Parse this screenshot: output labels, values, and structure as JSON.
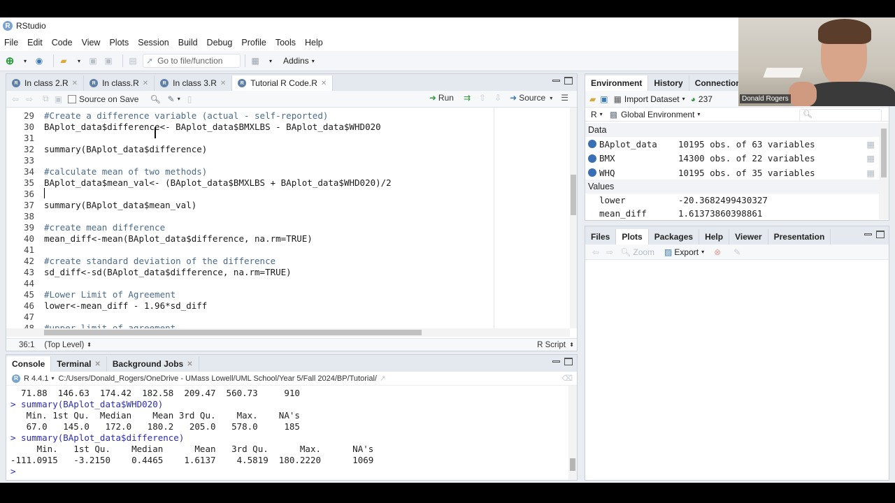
{
  "app": {
    "title": "RStudio"
  },
  "menu": [
    "File",
    "Edit",
    "Code",
    "View",
    "Plots",
    "Session",
    "Build",
    "Debug",
    "Profile",
    "Tools",
    "Help"
  ],
  "toolbar": {
    "goto_placeholder": "Go to file/function",
    "addins": "Addins"
  },
  "source": {
    "tabs": [
      {
        "label": "In class 2.R",
        "active": false
      },
      {
        "label": "In class.R",
        "active": false
      },
      {
        "label": "In class 3.R",
        "active": false
      },
      {
        "label": "Tutorial R Code.R",
        "active": true
      }
    ],
    "source_on_save": "Source on Save",
    "run": "Run",
    "source_btn": "Source",
    "lines": [
      {
        "n": "29",
        "code": "#Create a difference variable (actual - self-reported)",
        "type": "comment"
      },
      {
        "n": "30",
        "code": "BAplot_data$difference<- BAplot_data$BMXLBS - BAplot_data$WHD020",
        "type": "code"
      },
      {
        "n": "31",
        "code": "",
        "type": "code"
      },
      {
        "n": "32",
        "code": "summary(BAplot_data$difference)",
        "type": "code"
      },
      {
        "n": "33",
        "code": "",
        "type": "code"
      },
      {
        "n": "34",
        "code": "#calculate mean of two methods)",
        "type": "comment"
      },
      {
        "n": "35",
        "code": "BAplot_data$mean_val<- (BAplot_data$BMXLBS + BAplot_data$WHD020)/2",
        "type": "code"
      },
      {
        "n": "36",
        "code": "",
        "type": "code"
      },
      {
        "n": "37",
        "code": "summary(BAplot_data$mean_val)",
        "type": "code"
      },
      {
        "n": "38",
        "code": "",
        "type": "code"
      },
      {
        "n": "39",
        "code": "#create mean difference",
        "type": "comment"
      },
      {
        "n": "40",
        "code": "mean_diff<-mean(BAplot_data$difference, na.rm=TRUE)",
        "type": "code"
      },
      {
        "n": "41",
        "code": "",
        "type": "code"
      },
      {
        "n": "42",
        "code": "#create standard deviation of the difference",
        "type": "comment"
      },
      {
        "n": "43",
        "code": "sd_diff<-sd(BAplot_data$difference, na.rm=TRUE)",
        "type": "code"
      },
      {
        "n": "44",
        "code": "",
        "type": "code"
      },
      {
        "n": "45",
        "code": "#Lower Limit of Agreement",
        "type": "comment"
      },
      {
        "n": "46",
        "code": "lower<-mean_diff - 1.96*sd_diff",
        "type": "code"
      },
      {
        "n": "47",
        "code": "",
        "type": "code"
      },
      {
        "n": "48",
        "code": "#upper limit of agreement",
        "type": "comment"
      }
    ],
    "position": "36:1",
    "scope": "(Top Level)",
    "filetype": "R Script"
  },
  "console": {
    "tabs": [
      "Console",
      "Terminal",
      "Background Jobs"
    ],
    "r_version": "R 4.4.1",
    "path": "C:/Users/Donald_Rogers/OneDrive - UMass Lowell/UML School/Year 5/Fall 2024/BP/Tutorial/",
    "lines": [
      {
        "text": "  71.88  146.63  174.42  182.58  209.47  560.73     910",
        "type": "out"
      },
      {
        "text": "> summary(BAplot_data$WHD020)",
        "type": "cmd"
      },
      {
        "text": "   Min. 1st Qu.  Median    Mean 3rd Qu.    Max.    NA's ",
        "type": "out"
      },
      {
        "text": "   67.0   145.0   172.0   180.2   205.0   578.0     185 ",
        "type": "out"
      },
      {
        "text": "> summary(BAplot_data$difference)",
        "type": "cmd"
      },
      {
        "text": "     Min.   1st Qu.    Median      Mean   3rd Qu.      Max.      NA's ",
        "type": "out"
      },
      {
        "text": "-111.0915   -3.2150    0.4465    1.6137    4.5819  180.2220      1069 ",
        "type": "out"
      },
      {
        "text": "> ",
        "type": "cmd"
      }
    ]
  },
  "environment": {
    "tabs": [
      "Environment",
      "History",
      "Connections"
    ],
    "import_dataset": "Import Dataset",
    "memory": "237",
    "lang": "R",
    "scope": "Global Environment",
    "data_header": "Data",
    "data": [
      {
        "name": "BAplot_data",
        "value": "10195 obs. of 63 variables"
      },
      {
        "name": "BMX",
        "value": "14300 obs. of 22 variables"
      },
      {
        "name": "WHQ",
        "value": "10195 obs. of 35 variables"
      }
    ],
    "values_header": "Values",
    "values": [
      {
        "name": "lower",
        "value": "-20.3682499430327"
      },
      {
        "name": "mean_diff",
        "value": "1.61373860398861"
      }
    ]
  },
  "files": {
    "tabs": [
      "Files",
      "Plots",
      "Packages",
      "Help",
      "Viewer",
      "Presentation"
    ],
    "active": "Plots",
    "zoom": "Zoom",
    "export": "Export"
  },
  "webcam": {
    "label": "Donald Rogers"
  }
}
